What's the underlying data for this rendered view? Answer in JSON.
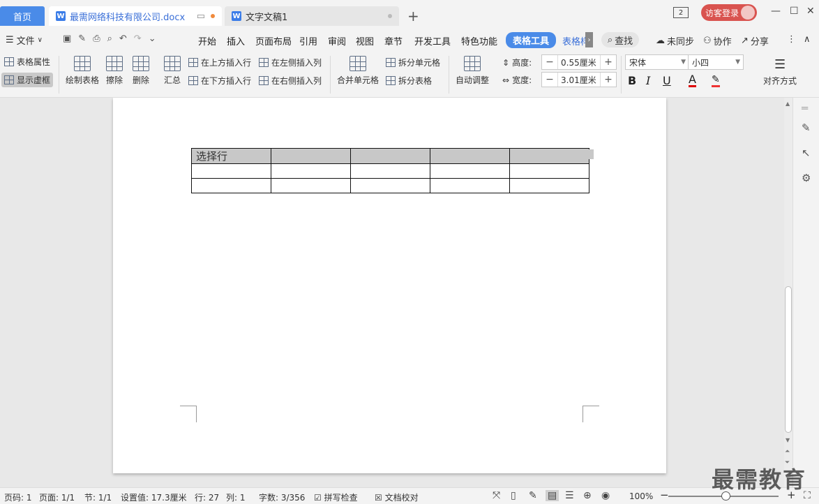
{
  "titlebar": {
    "home_tab": "首页",
    "tabs": [
      {
        "label": "最需网络科技有限公司.docx",
        "icon": "W"
      },
      {
        "label": "文字文稿1",
        "icon": "W"
      }
    ],
    "window_count": "2",
    "login_label": "访客登录"
  },
  "menubar": {
    "file_label": "文件",
    "items": [
      "开始",
      "插入",
      "页面布局",
      "引用",
      "审阅",
      "视图",
      "章节",
      "开发工具",
      "特色功能"
    ],
    "active_tool": "表格工具",
    "next_tool": "表格样",
    "search_label": "查找",
    "sync_label": "未同步",
    "collab_label": "协作",
    "share_label": "分享"
  },
  "ribbon": {
    "table_props": "表格属性",
    "show_gridlines": "显示虚框",
    "draw_table": "绘制表格",
    "erase": "擦除",
    "delete": "删除",
    "summary": "汇总",
    "insert_row_above": "在上方插入行",
    "insert_row_below": "在下方插入行",
    "insert_col_left": "在左侧插入列",
    "insert_col_right": "在右侧插入列",
    "merge_cells": "合并单元格",
    "split_cells": "拆分单元格",
    "split_table": "拆分表格",
    "auto_fit": "自动调整",
    "height_label": "高度:",
    "height_value": "0.55厘米",
    "width_label": "宽度:",
    "width_value": "3.01厘米",
    "font_name": "宋体",
    "font_size": "小四",
    "align_label": "对齐方式"
  },
  "document": {
    "table": {
      "rows": [
        [
          "选择行",
          "",
          "",
          "",
          ""
        ],
        [
          "",
          "",
          "",
          "",
          ""
        ],
        [
          "",
          "",
          "",
          "",
          ""
        ]
      ],
      "selected_row": 0
    }
  },
  "statusbar": {
    "page_num": "页码: 1",
    "page_count": "页面: 1/1",
    "section": "节: 1/1",
    "setting": "设置值: 17.3厘米",
    "row": "行: 27",
    "col": "列: 1",
    "word_count": "字数: 3/356",
    "spell_check": "拼写检查",
    "doc_proof": "文档校对",
    "zoom": "100%",
    "zoom_fraction": 0.52
  },
  "watermark": "最需教育",
  "colors": {
    "accent": "#4a8be8",
    "login": "#d9534f",
    "selection": "#c8c8c8"
  }
}
